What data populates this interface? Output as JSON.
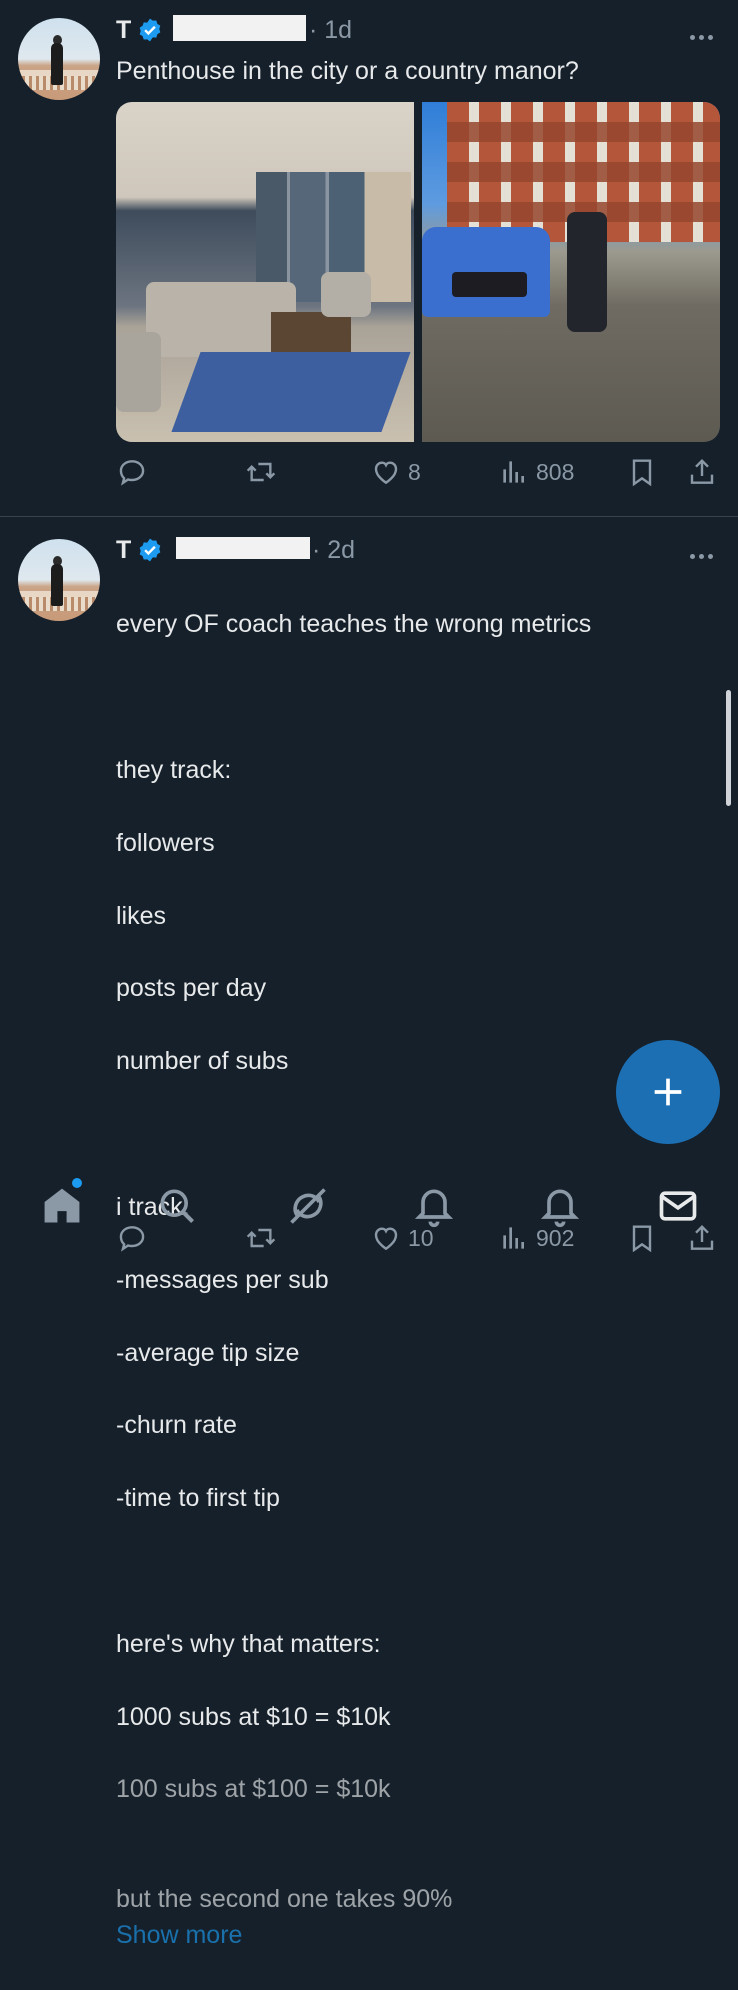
{
  "tweets": [
    {
      "author": "T",
      "time": "· 1d",
      "text": "Penthouse in the city or a country manor?",
      "stats": {
        "likes": "8",
        "views": "808"
      }
    },
    {
      "author": "T",
      "time": "· 2d",
      "lines": [
        "every OF coach teaches the wrong metrics",
        "",
        "they track:",
        "followers",
        "likes",
        "posts per day",
        "number of subs",
        "",
        "i track:",
        "-messages per sub",
        "-average tip size",
        "-churn rate",
        "-time to first tip",
        "",
        "here's why that matters:",
        "1000 subs at $10 = $10k"
      ],
      "faded_line": "100 subs at $100 = $10k",
      "last_line": "but the second one takes 90%",
      "show_more": "Show more",
      "stats": {
        "likes": "10",
        "views": "902"
      }
    }
  ],
  "colors": {
    "background": "#15202b",
    "accent": "#1d9bf0",
    "muted": "#8b98a5",
    "fab": "#1d6fb3"
  },
  "icons": [
    "verified-badge-icon",
    "more-icon",
    "reply-icon",
    "retweet-icon",
    "like-icon",
    "views-icon",
    "bookmark-icon",
    "share-icon",
    "compose-plus-icon",
    "home-icon",
    "search-icon",
    "grok-icon",
    "notifications-icon",
    "messages-icon"
  ]
}
